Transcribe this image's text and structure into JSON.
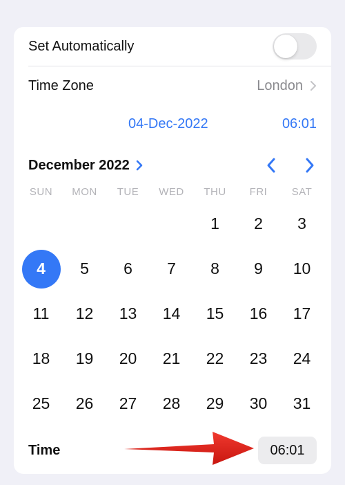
{
  "settings": {
    "set_automatically_label": "Set Automatically",
    "set_automatically_on": false,
    "time_zone_label": "Time Zone",
    "time_zone_value": "London"
  },
  "datetime": {
    "date": "04-Dec-2022",
    "time": "06:01"
  },
  "calendar": {
    "month_title": "December 2022",
    "weekdays": [
      "SUN",
      "MON",
      "TUE",
      "WED",
      "THU",
      "FRI",
      "SAT"
    ],
    "first_weekday_index": 4,
    "days_in_month": 31,
    "selected_day": 4
  },
  "time_row": {
    "label": "Time",
    "value": "06:01"
  },
  "colors": {
    "accent": "#3478f6",
    "arrow": "#e0221b"
  }
}
